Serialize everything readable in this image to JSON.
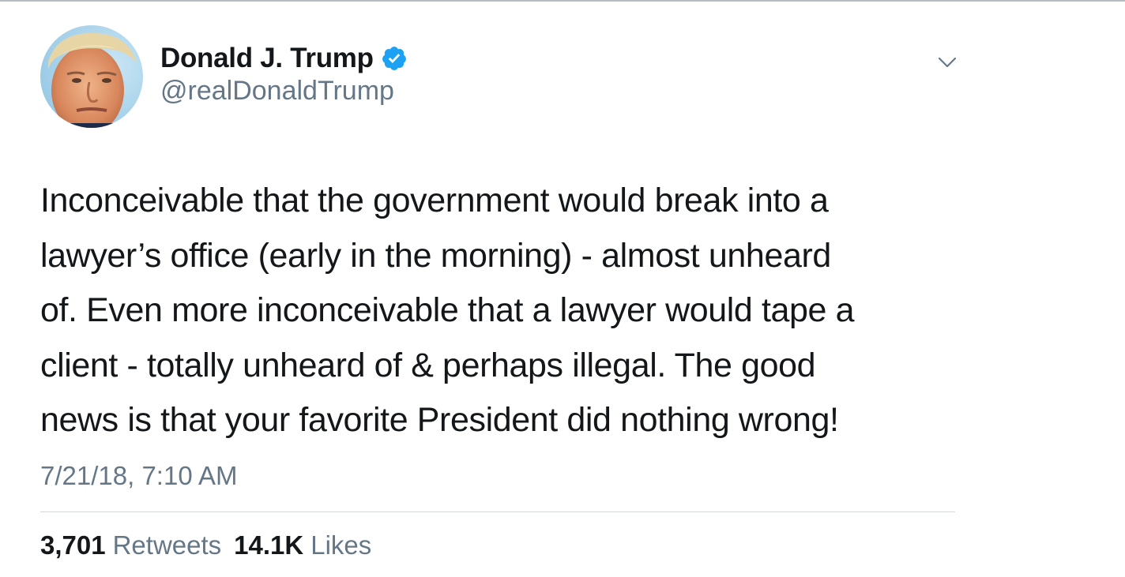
{
  "tweet": {
    "author": {
      "display_name": "Donald J. Trump",
      "handle": "@realDonaldTrump",
      "verified": true,
      "avatar_icon": "profile-photo",
      "verified_icon": "verified-badge-icon"
    },
    "menu_icon": "chevron-down-icon",
    "text_lines": [
      "Inconceivable that the government would break into a",
      "lawyer’s office (early in the morning) - almost unheard",
      "of. Even more inconceivable that a lawyer would tape a",
      "client - totally unheard of & perhaps illegal. The good",
      "news is that your favorite President did nothing wrong!"
    ],
    "timestamp": "7/21/18, 7:10 AM",
    "stats": {
      "retweets_count": "3,701",
      "retweets_label": "Retweets",
      "likes_count": "14.1K",
      "likes_label": "Likes"
    }
  },
  "colors": {
    "text_primary": "#14171a",
    "text_secondary": "#657786",
    "verified_blue": "#1da1f2",
    "divider": "#d4d8dc"
  }
}
